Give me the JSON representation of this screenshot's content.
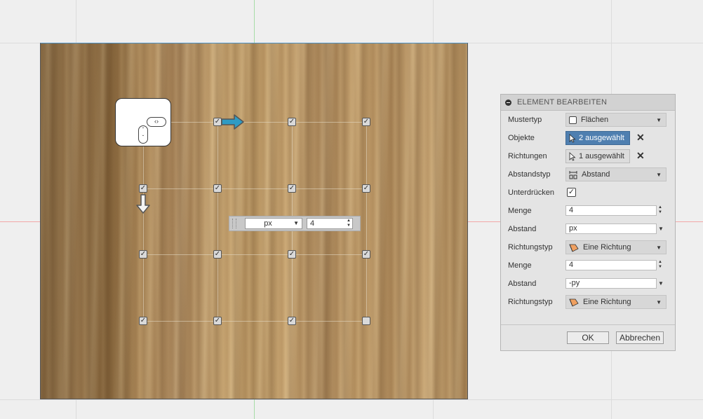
{
  "panel": {
    "title": "ELEMENT BEARBEITEN",
    "rows": [
      {
        "label": "Mustertyp",
        "value": "Flächen"
      },
      {
        "label": "Objekte",
        "value": "2 ausgewählt"
      },
      {
        "label": "Richtungen",
        "value": "1 ausgewählt"
      },
      {
        "label": "Abstandstyp",
        "value": "Abstand"
      },
      {
        "label": "Unterdrücken",
        "checked": true
      },
      {
        "label": "Menge",
        "value": "4"
      },
      {
        "label": "Abstand",
        "value": "px"
      },
      {
        "label": "Richtungstyp",
        "value": "Eine Richtung"
      },
      {
        "label": "Menge",
        "value": "4"
      },
      {
        "label": "Abstand",
        "value": "-py"
      },
      {
        "label": "Richtungstyp",
        "value": "Eine Richtung"
      }
    ],
    "ok_label": "OK",
    "cancel_label": "Abbrechen"
  },
  "canvas_input": {
    "unit": "px",
    "value": "4"
  },
  "colors": {
    "selection_blue": "#4f7fb0",
    "arrow_blue": "#2f9bc4",
    "axis_green": "#a8dca8",
    "axis_red": "#f2a8a8"
  },
  "icons": [
    "collapse-icon",
    "cursor-icon",
    "spacing-icon",
    "direction-icon",
    "close-icon",
    "checkbox-icon",
    "arrow-right-icon",
    "arrow-down-icon",
    "nav-cube-icon"
  ]
}
